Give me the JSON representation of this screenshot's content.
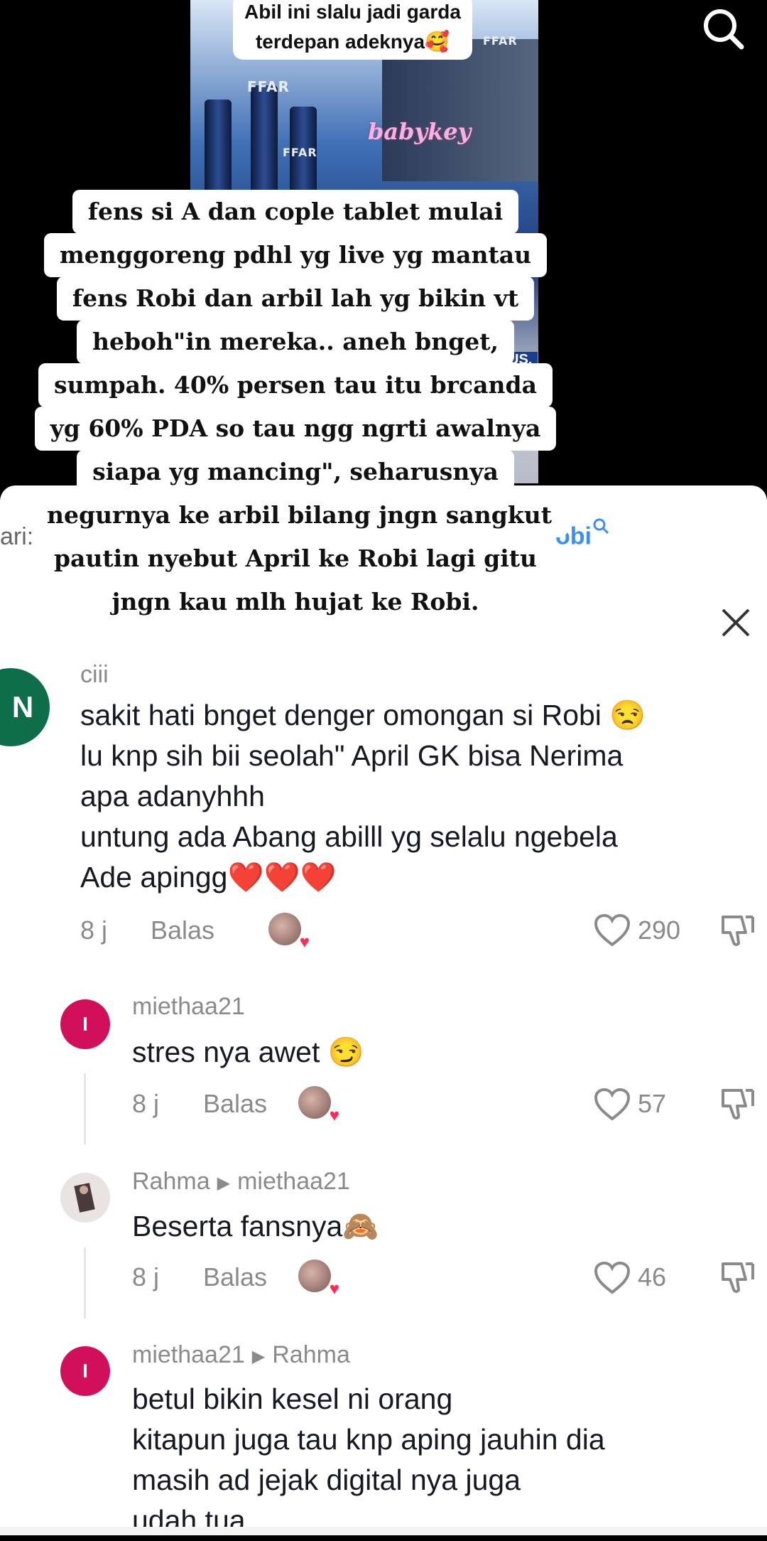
{
  "video": {
    "caption_line1": "Abil ini slalu jadi garda",
    "caption_line2": "terdepan adeknya🥰",
    "brand": "FFAR",
    "watermark": "babykey",
    "badge": "US."
  },
  "header": {
    "prefix": "ari:",
    "query": "obi"
  },
  "overlay": {
    "lines": [
      "fens si A dan cople tablet mulai",
      "menggoreng pdhl yg live yg mantau",
      "fens Robi dan arbil lah yg bikin vt",
      "heboh\"in mereka.. aneh bnget,",
      "sumpah. 40% persen tau itu brcanda",
      "yg 60% PDA so tau ngg ngrti awalnya",
      "siapa yg mancing\", seharusnya",
      "negurnya ke arbil bilang jngn sangkut",
      "pautin nyebut April ke Robi lagi gitu",
      "jngn kau mlh hujat ke Robi."
    ]
  },
  "comments": [
    {
      "avatar_letter": "N",
      "avatar_color": "#0f6e4a",
      "username": "ciii",
      "lines": [
        "sakit hati bnget denger omongan si Robi 😒",
        "lu knp sih bii seolah\" April GK bisa Nerima",
        "apa adanyhhh",
        "untung ada Abang abilll yg selalu ngebela",
        "Ade apingg❤️❤️❤️"
      ],
      "time": "8 j",
      "reply_label": "Balas",
      "likes": "290"
    },
    {
      "avatar_letter": "I",
      "avatar_color": "#d10f5a",
      "username": "miethaa21",
      "lines": [
        "stres nya awet 😏"
      ],
      "time": "8 j",
      "reply_label": "Balas",
      "likes": "57"
    },
    {
      "avatar_letter": "",
      "avatar_color": "#e9e4e2",
      "username": "Rahma",
      "reply_to": "miethaa21",
      "lines": [
        "Beserta fansnya🙈"
      ],
      "time": "8 j",
      "reply_label": "Balas",
      "likes": "46"
    },
    {
      "avatar_letter": "I",
      "avatar_color": "#d10f5a",
      "username": "miethaa21",
      "reply_to": "Rahma",
      "lines": [
        "betul bikin kesel ni orang",
        "kitapun juga tau knp aping jauhin dia",
        "masih ad jejak digital nya juga",
        "udah tua"
      ]
    }
  ],
  "icons": {
    "search": "search-icon",
    "close": "close-icon",
    "like": "heart-outline-icon",
    "dislike": "thumbs-down-icon"
  }
}
